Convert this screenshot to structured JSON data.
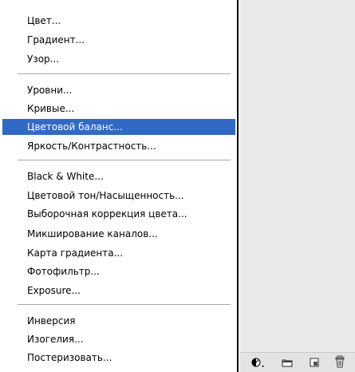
{
  "menu": {
    "groups": [
      {
        "items": [
          {
            "label": "Цвет..."
          },
          {
            "label": "Градиент..."
          },
          {
            "label": "Узор..."
          }
        ]
      },
      {
        "items": [
          {
            "label": "Уровни..."
          },
          {
            "label": "Кривые..."
          },
          {
            "label": "Цветовой баланс...",
            "highlighted": true
          },
          {
            "label": "Яркость/Контрастность..."
          }
        ]
      },
      {
        "items": [
          {
            "label": "Black & White..."
          },
          {
            "label": "Цветовой тон/Насыщенность..."
          },
          {
            "label": "Выборочная коррекция цвета..."
          },
          {
            "label": "Микширование каналов..."
          },
          {
            "label": "Карта градиента..."
          },
          {
            "label": "Фотофильтр..."
          },
          {
            "label": "Exposure..."
          }
        ]
      },
      {
        "items": [
          {
            "label": "Инверсия"
          },
          {
            "label": "Изогелия..."
          },
          {
            "label": "Постеризовать..."
          }
        ]
      }
    ]
  },
  "panel_footer": {
    "icons": [
      "adjustment-layer-icon",
      "new-group-icon",
      "new-layer-icon",
      "trash-icon"
    ]
  },
  "colors": {
    "highlight": "#316ac5",
    "panel": "#e9e9e9"
  }
}
